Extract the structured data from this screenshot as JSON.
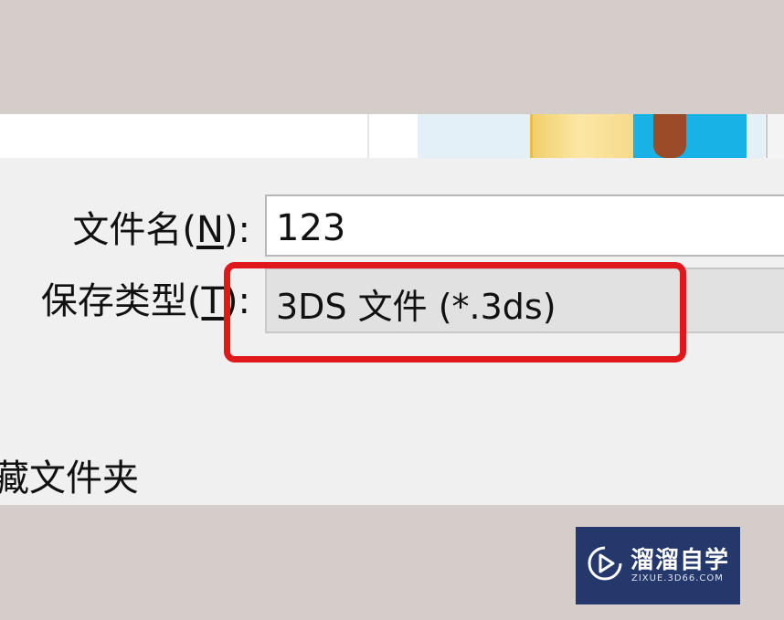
{
  "save_dialog": {
    "filename": {
      "label": "文件名(",
      "mnemonic": "N",
      "label_end": "):",
      "value": "123"
    },
    "filetype": {
      "label": "保存类型(",
      "mnemonic": "T",
      "label_end": "):",
      "selected": "3DS 文件 (*.3ds)"
    },
    "hide_folders": "藏文件夹"
  },
  "annotation": {
    "highlight_color": "#e0181b"
  },
  "watermark": {
    "title": "溜溜自学",
    "url": "ZIXUE.3D66.COM",
    "background": "#24386b",
    "icon": "play-icon"
  }
}
